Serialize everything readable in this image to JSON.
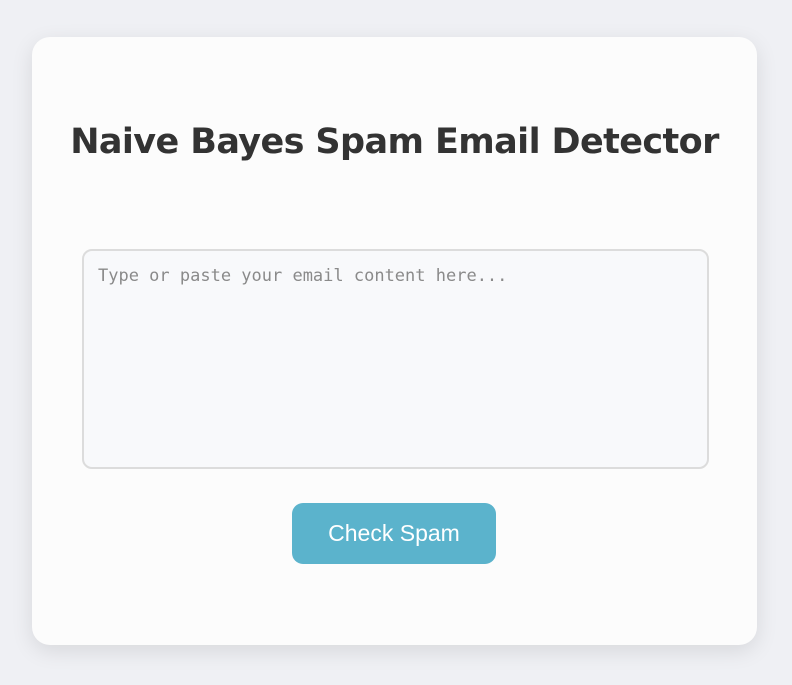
{
  "page": {
    "title": "Naive Bayes Spam Email Detector"
  },
  "email_input": {
    "value": "",
    "placeholder": "Type or paste your email content here..."
  },
  "actions": {
    "check_label": "Check Spam"
  },
  "colors": {
    "background": "#eff0f4",
    "card": "#fcfcfc",
    "title_text": "#333333",
    "input_bg": "#f8f9fb",
    "input_border": "#dcdcdc",
    "button_bg": "#5bb3cc",
    "button_text": "#ffffff"
  }
}
